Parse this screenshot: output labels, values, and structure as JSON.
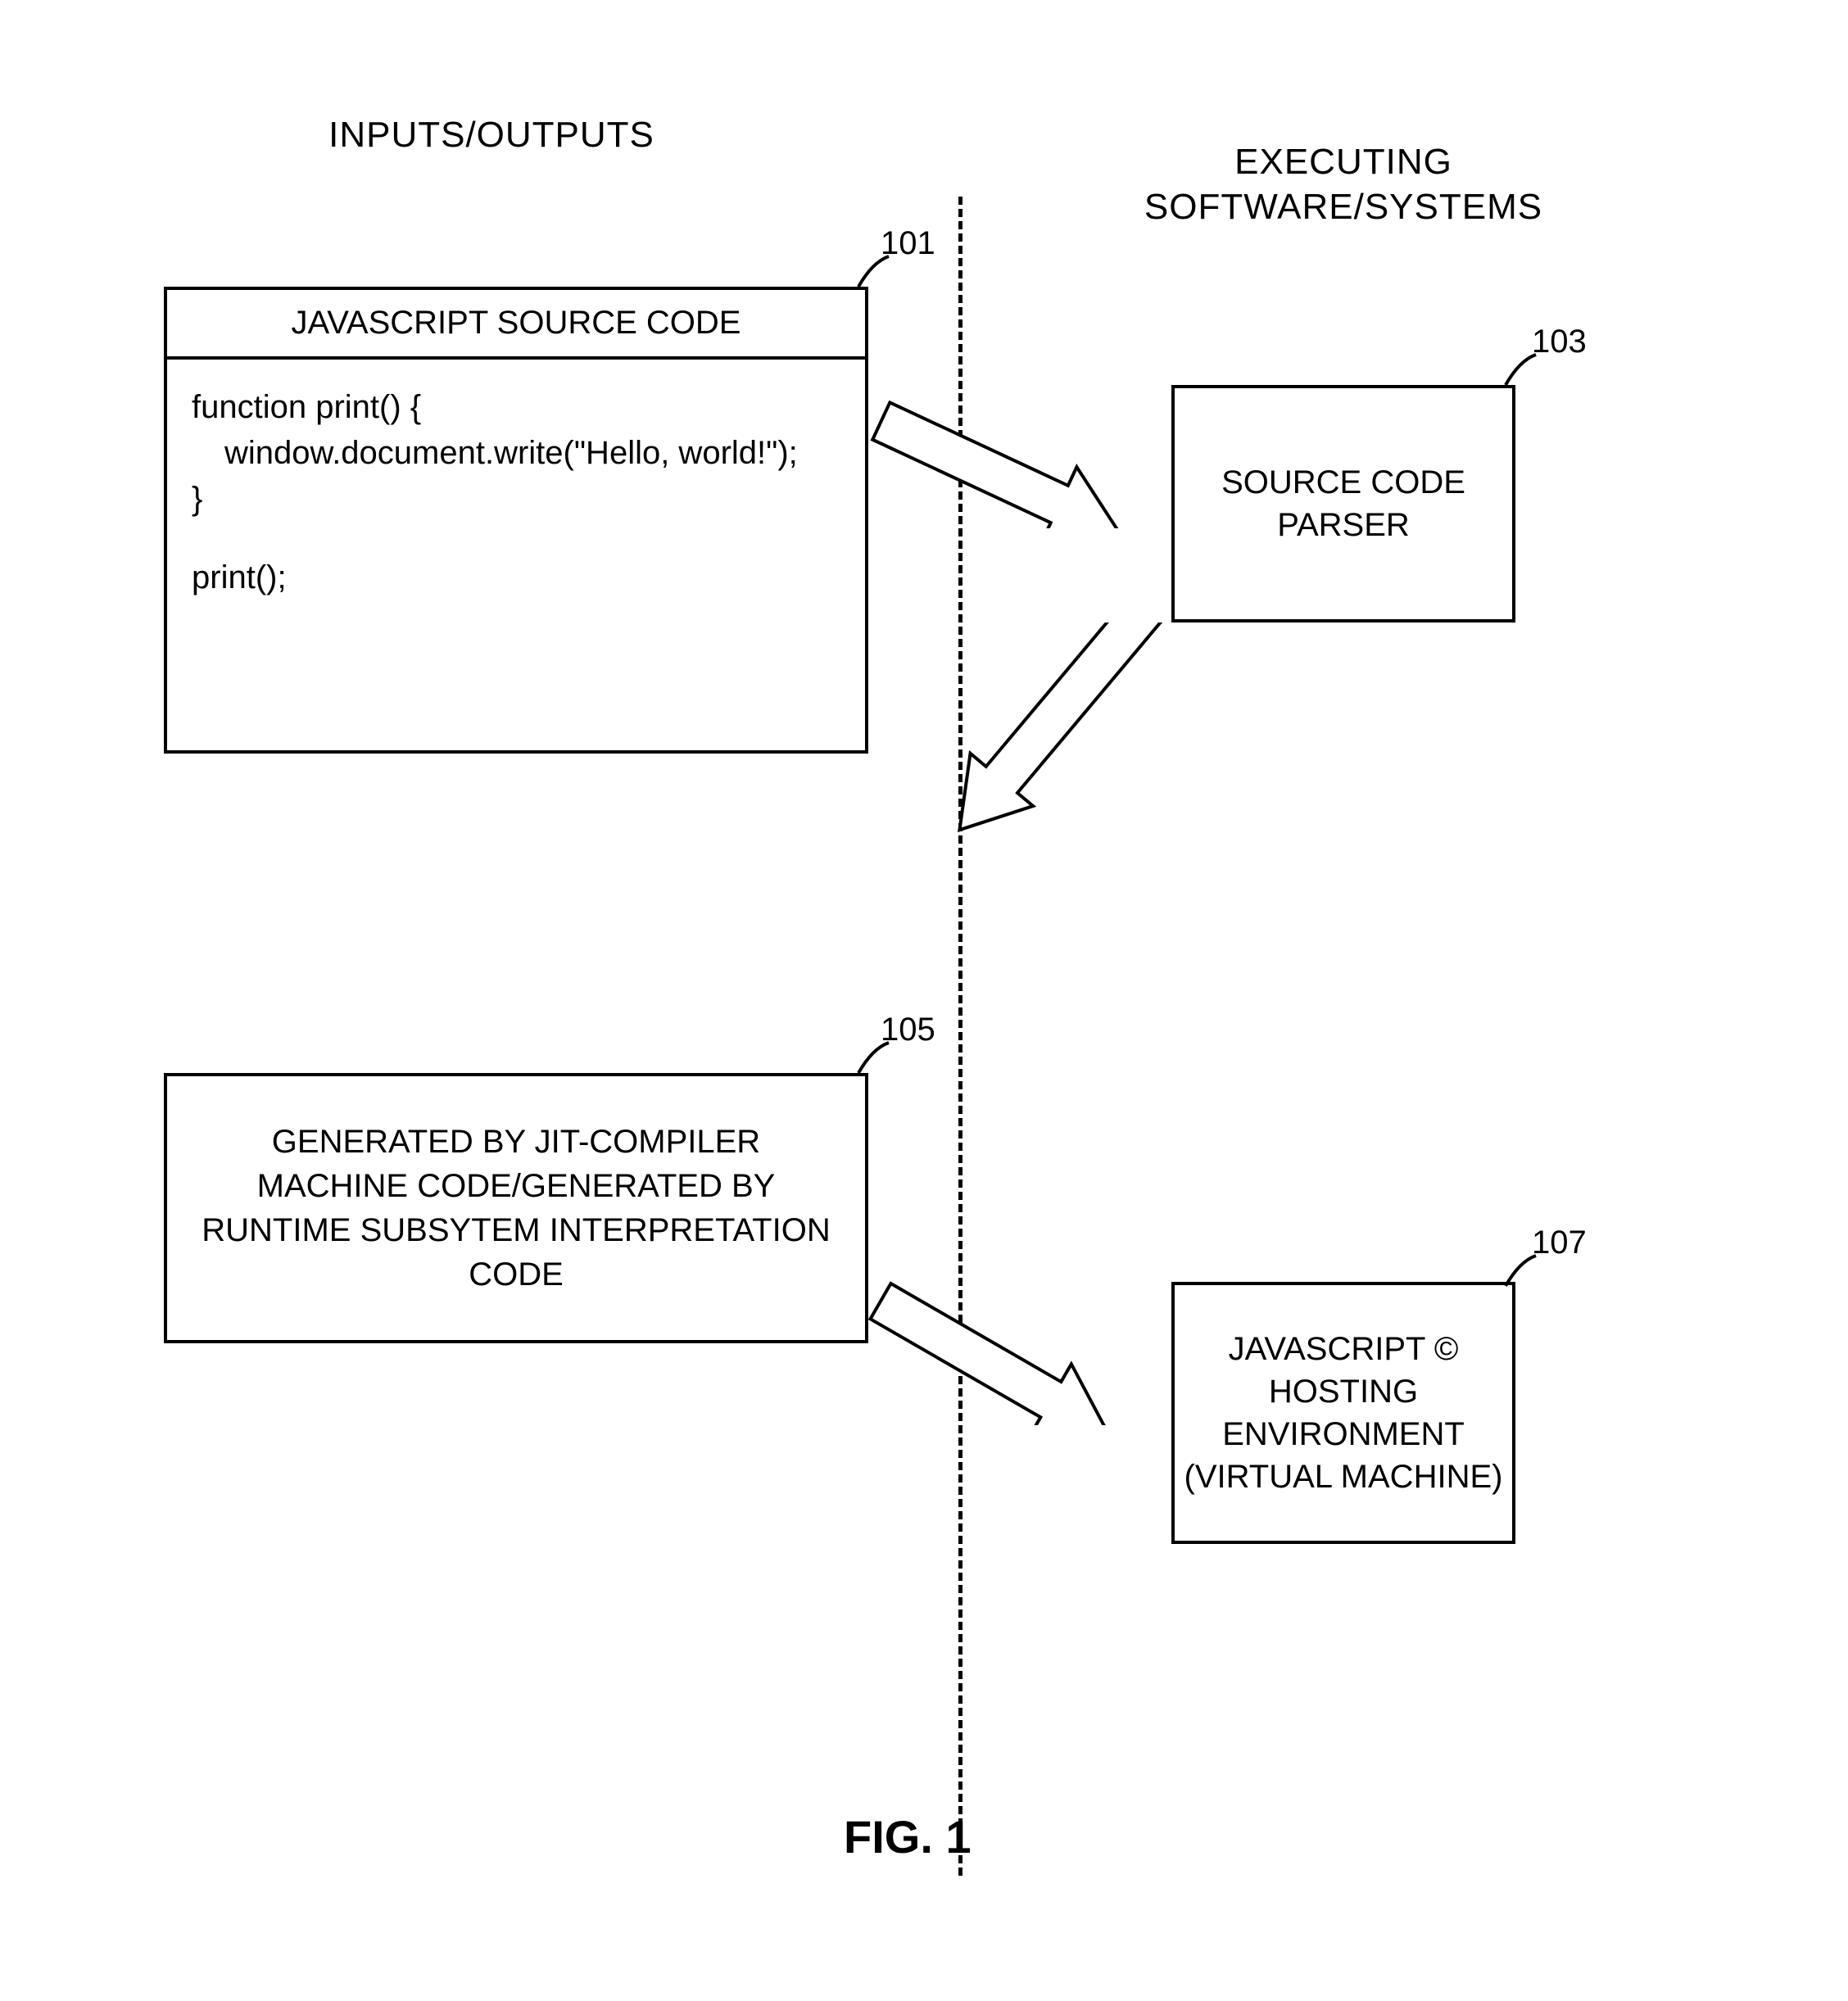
{
  "headings": {
    "left": "INPUTS/OUTPUTS",
    "right": "EXECUTING\nSOFTWARE/SYSTEMS"
  },
  "box101": {
    "ref": "101",
    "title": "JAVASCRIPT SOURCE CODE",
    "code_line1": "function print() {",
    "code_line2": "window.document.write(\"Hello, world!\");",
    "code_line3": "}",
    "code_line4": "print();"
  },
  "box103": {
    "ref": "103",
    "text": "SOURCE CODE PARSER"
  },
  "box105": {
    "ref": "105",
    "text": "GENERATED BY JIT-COMPILER\nMACHINE CODE/GENERATED BY\nRUNTIME SUBSYTEM INTERPRETATION\nCODE"
  },
  "box107": {
    "ref": "107",
    "text": "JAVASCRIPT ©\nHOSTING\nENVIRONMENT\n(VIRTUAL MACHINE)"
  },
  "figure_label": "FIG. 1"
}
